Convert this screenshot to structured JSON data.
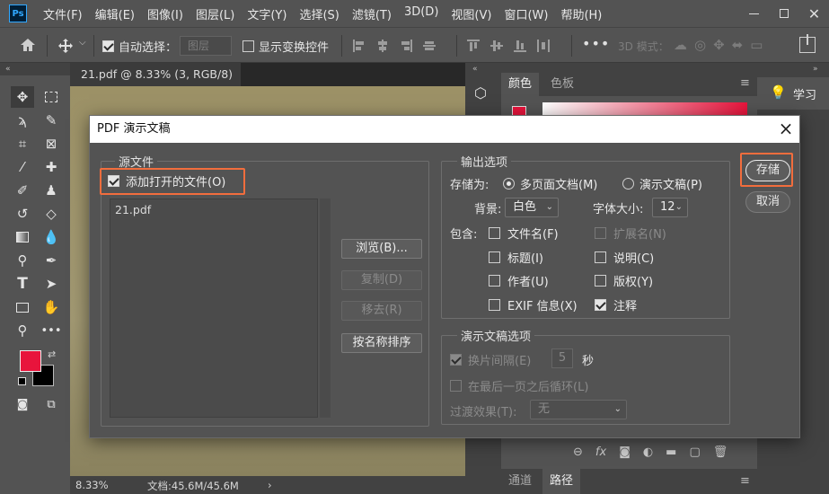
{
  "app": {
    "logo": "Ps"
  },
  "menu": [
    "文件(F)",
    "编辑(E)",
    "图像(I)",
    "图层(L)",
    "文字(Y)",
    "选择(S)",
    "滤镜(T)",
    "3D(D)",
    "视图(V)",
    "窗口(W)",
    "帮助(H)"
  ],
  "options": {
    "auto_select_label": "自动选择：",
    "auto_select_value": "图层",
    "show_transform_label": "显示变换控件",
    "mode_3d_label": "3D 模式："
  },
  "document": {
    "tab_label": "21.pdf @ 8.33% (3, RGB/8) *",
    "zoom": "8.33%",
    "doc_size": "文档:45.6M/45.6M"
  },
  "panels": {
    "color_tab": "颜色",
    "swatches_tab": "色板",
    "learn_label": "学习",
    "channels_tab": "通道",
    "paths_tab": "路径"
  },
  "dialog": {
    "title": "PDF 演示文稿",
    "source_legend": "源文件",
    "add_open_files_label": "添加打开的文件(O)",
    "file_list": [
      "21.pdf"
    ],
    "browse_button": "浏览(B)...",
    "duplicate_button": "复制(D)",
    "remove_button": "移去(R)",
    "sort_button": "按名称排序",
    "output_legend": "输出选项",
    "save_as_label": "存储为:",
    "multipage_label": "多页面文档(M)",
    "presentation_label": "演示文稿(P)",
    "background_label": "背景:",
    "background_value": "白色",
    "font_size_label": "字体大小:",
    "font_size_value": "12",
    "include_label": "包含:",
    "include_options": [
      {
        "label": "文件名(F)",
        "checked": false,
        "enabled": true
      },
      {
        "label": "扩展名(N)",
        "checked": false,
        "enabled": false
      },
      {
        "label": "标题(I)",
        "checked": false,
        "enabled": true
      },
      {
        "label": "说明(C)",
        "checked": false,
        "enabled": true
      },
      {
        "label": "作者(U)",
        "checked": false,
        "enabled": true
      },
      {
        "label": "版权(Y)",
        "checked": false,
        "enabled": true
      },
      {
        "label": "EXIF 信息(X)",
        "checked": false,
        "enabled": true
      },
      {
        "label": "注释",
        "checked": true,
        "enabled": true
      }
    ],
    "slideshow_legend": "演示文稿选项",
    "advance_label": "换片间隔(E)",
    "advance_value": "5",
    "seconds_label": "秒",
    "loop_label": "在最后一页之后循环(L)",
    "transition_label": "过渡效果(T):",
    "transition_value": "无",
    "save_button": "存储",
    "cancel_button": "取消"
  },
  "colors": {
    "highlight": "#f26d3d",
    "foreground": "#e8143c",
    "background": "#000000"
  }
}
